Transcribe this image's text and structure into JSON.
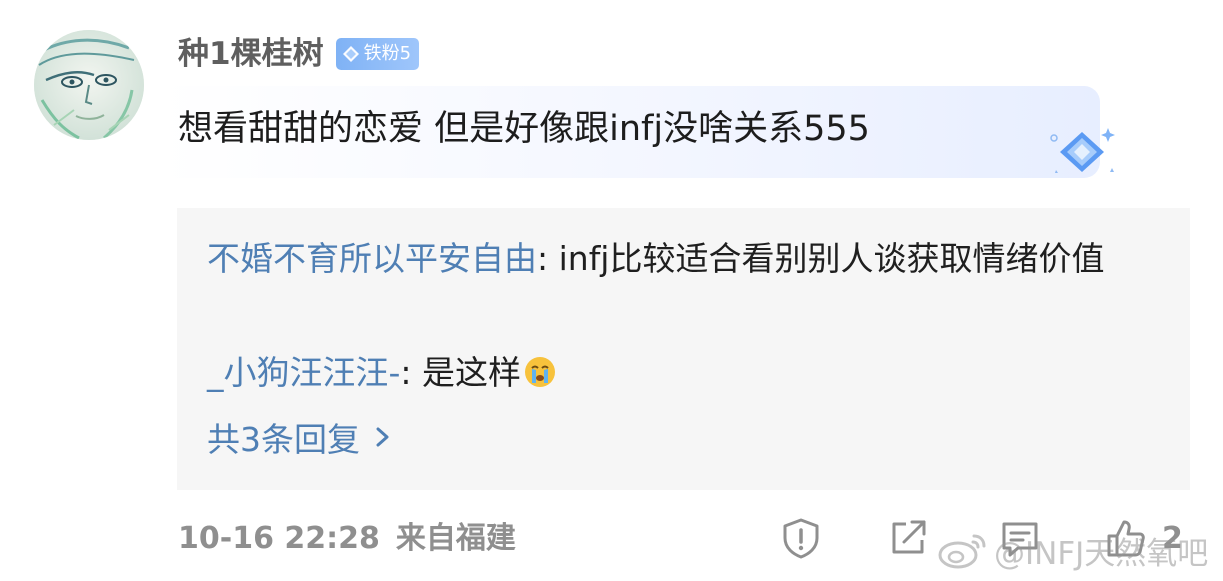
{
  "comment": {
    "author": "种1棵桂树",
    "fan_badge": "铁粉5",
    "text": "想看甜甜的恋爱 但是好像跟infj没啥关系555"
  },
  "replies": [
    {
      "user": "不婚不育所以平安自由",
      "separator": ": ",
      "text": "infj比较适合看别别人谈获取情绪价值"
    },
    {
      "user": "_小狗汪汪汪-",
      "separator": ": ",
      "text": "是这样"
    }
  ],
  "more_replies_label": "共3条回复",
  "meta": {
    "time": "10-16 22:28",
    "location": "来自福建"
  },
  "actions": {
    "like_count": "2"
  },
  "watermark": "@INFJ天然氧吧",
  "colors": {
    "reply_user": "#4f7fb4",
    "badge": "#8dbcf8",
    "meta_text": "#8f8f8f",
    "reply_bg": "#f6f6f6"
  },
  "icons": {
    "avatar": "sketch-portrait-avatar",
    "badge": "diamond-icon",
    "decor": "diamond-sparkle-icon",
    "emoji": "crying-face-emoji",
    "more": "chevron-right-icon",
    "report": "report-icon",
    "share": "share-icon",
    "comment": "comment-icon",
    "like": "thumbs-up-icon",
    "watermark": "weibo-logo-icon"
  }
}
